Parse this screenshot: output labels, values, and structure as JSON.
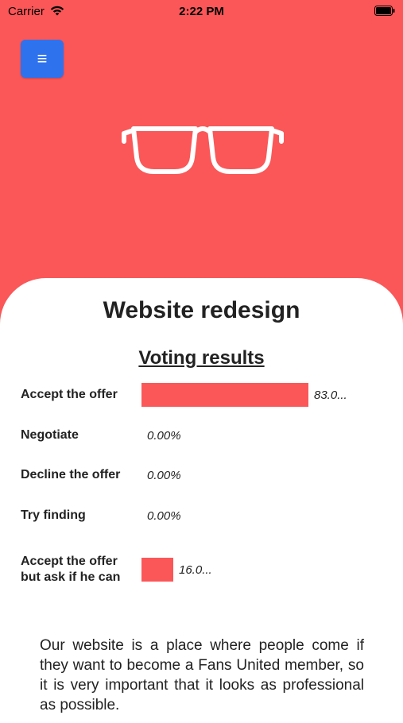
{
  "status_bar": {
    "carrier": "Carrier",
    "time": "2:22 PM"
  },
  "header": {
    "menu_icon": "hamburger-icon",
    "menu_label": "≡",
    "logo_icon": "glasses-icon"
  },
  "content": {
    "title": "Website redesign",
    "subtitle": "Voting results",
    "options": [
      {
        "label": "Accept the offer",
        "percent_text": "83.0...",
        "value": 83.0
      },
      {
        "label": "Negotiate",
        "percent_text": "0.00%",
        "value": 0
      },
      {
        "label": "Decline the offer",
        "percent_text": "0.00%",
        "value": 0
      },
      {
        "label": "Try finding",
        "percent_text": "0.00%",
        "value": 0
      },
      {
        "label": "Accept the offer but ask if he can",
        "percent_text": "16.0...",
        "value": 16.0
      }
    ],
    "description": "Our website is a place where people come if they want to become a Fans United member, so it is very important that it looks as professional as possible."
  },
  "colors": {
    "background": "#fb5758",
    "accent_button": "#2f72ee",
    "bar": "#fb5758"
  }
}
